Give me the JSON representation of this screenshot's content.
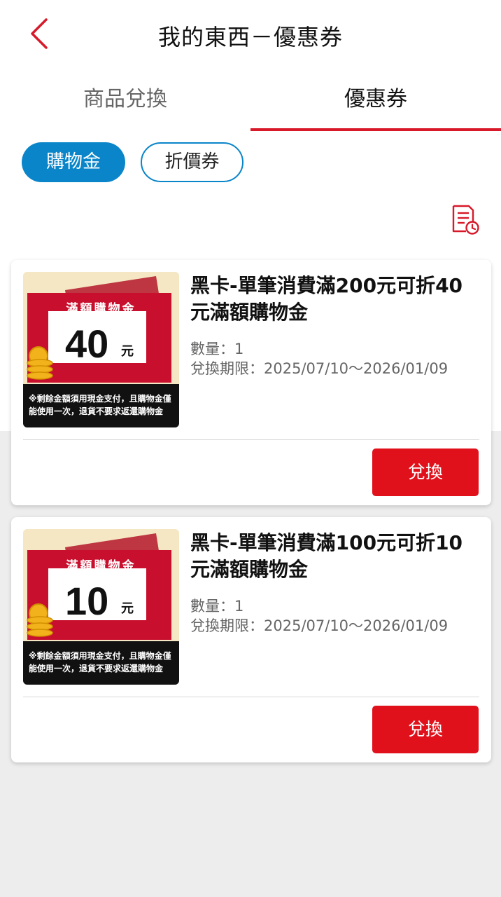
{
  "header": {
    "title": "我的東西－優惠券",
    "back_icon": "chevron-left-icon"
  },
  "tabs": [
    {
      "label": "商品兌換",
      "active": false
    },
    {
      "label": "優惠券",
      "active": true
    }
  ],
  "filters": [
    {
      "label": "購物金",
      "selected": true
    },
    {
      "label": "折價券",
      "selected": false
    }
  ],
  "history_icon": "document-clock-icon",
  "coupons": [
    {
      "image": {
        "label": "滿額購物金",
        "amount": "40",
        "unit": "元",
        "note": "※剩餘金額須用現金支付，且購物金僅能使用一次，退貨不要求返還購物金"
      },
      "name": "黑卡-單筆消費滿200元可折40元滿額購物金",
      "quantity": "數量：1",
      "period": "兌換期限：2025/07/10～2026/01/09",
      "button": "兌換"
    },
    {
      "image": {
        "label": "滿額購物金",
        "amount": "10",
        "unit": "元",
        "note": "※剩餘金額須用現金支付，且購物金僅能使用一次，退貨不要求返還購物金"
      },
      "name": "黑卡-單筆消費滿100元可折10元滿額購物金",
      "quantity": "數量：1",
      "period": "兌換期限：2025/07/10～2026/01/09",
      "button": "兌換"
    }
  ],
  "colors": {
    "accent_red": "#e0111b",
    "tab_underline": "#d7192a",
    "chip_blue": "#0a85c9"
  }
}
